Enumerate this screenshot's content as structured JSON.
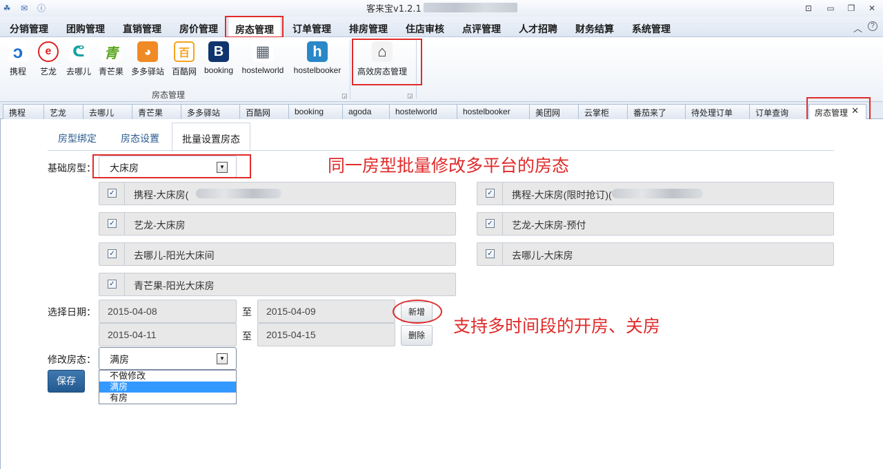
{
  "window": {
    "title": "客来宝v1.2.1 -",
    "controls": [
      "restore-icon",
      "minimize-icon",
      "maximize-icon",
      "close-icon"
    ]
  },
  "menu": {
    "items": [
      "分销管理",
      "团购管理",
      "直销管理",
      "房价管理",
      "房态管理",
      "订单管理",
      "排房管理",
      "住店审核",
      "点评管理",
      "人才招聘",
      "财务结算",
      "系统管理"
    ],
    "active": "房态管理"
  },
  "ribbon": {
    "buttons": [
      {
        "label": "携程",
        "icon": "ctrip-icon",
        "color": "#1e6fd0"
      },
      {
        "label": "艺龙",
        "icon": "elong-icon",
        "color": "#e02020"
      },
      {
        "label": "去哪儿",
        "icon": "qunar-icon",
        "color": "#17a2a0"
      },
      {
        "label": "青芒果",
        "icon": "qingmangguo-icon",
        "glyph": "青",
        "color": "#5aa61e"
      },
      {
        "label": "多多驿站",
        "icon": "duoduo-icon",
        "color": "#f08a24"
      },
      {
        "label": "百酷网",
        "icon": "baiku-icon",
        "glyph": "百",
        "color": "#f7a21b"
      },
      {
        "label": "booking",
        "icon": "booking-icon",
        "glyph": "B",
        "color": "#10356e"
      },
      {
        "label": "hostelworld",
        "icon": "hostelworld-icon",
        "color": "#56606e"
      },
      {
        "label": "hostelbooker",
        "icon": "hostelbooker-icon",
        "glyph": "h",
        "color": "#2a87c8"
      }
    ],
    "group_label": "房态管理",
    "extra_button": {
      "label": "高效房态管理",
      "icon": "house-icon"
    }
  },
  "tabs": {
    "items": [
      "携程",
      "艺龙",
      "去哪儿",
      "青芒果",
      "多多驿站",
      "百酷网",
      "booking",
      "agoda",
      "hostelworld",
      "hostelbooker",
      "美团网",
      "云掌柜",
      "番茄来了",
      "待处理订单",
      "订单查询"
    ],
    "active": "房态管理"
  },
  "subtabs": {
    "items": [
      "房型绑定",
      "房态设置"
    ],
    "active": "批量设置房态"
  },
  "form": {
    "base_room_label": "基础房型：",
    "base_room_value": "大床房",
    "channels": [
      {
        "label": "携程-大床房(",
        "checked": true
      },
      {
        "label": "携程-大床房(限时抢订)(",
        "checked": true
      },
      {
        "label": "艺龙-大床房",
        "checked": true
      },
      {
        "label": "艺龙-大床房-预付",
        "checked": true
      },
      {
        "label": "去哪儿-阳光大床间",
        "checked": true
      },
      {
        "label": "去哪儿-大床房",
        "checked": true
      },
      {
        "label": "青芒果-阳光大床房",
        "checked": true
      }
    ],
    "date_label": "选择日期：",
    "to_label": "至",
    "ranges": [
      {
        "start": "2015-04-08",
        "end": "2015-04-09"
      },
      {
        "start": "2015-04-11",
        "end": "2015-04-15"
      }
    ],
    "add_button": "新增",
    "delete_button": "删除",
    "status_label": "修改房态：",
    "status_value": "满房",
    "status_options": [
      "不做修改",
      "满房",
      "有房"
    ],
    "save_button": "保存"
  },
  "annotations": {
    "batch_note": "同一房型批量修改多平台的房态",
    "range_note": "支持多时间段的开房、关房"
  }
}
